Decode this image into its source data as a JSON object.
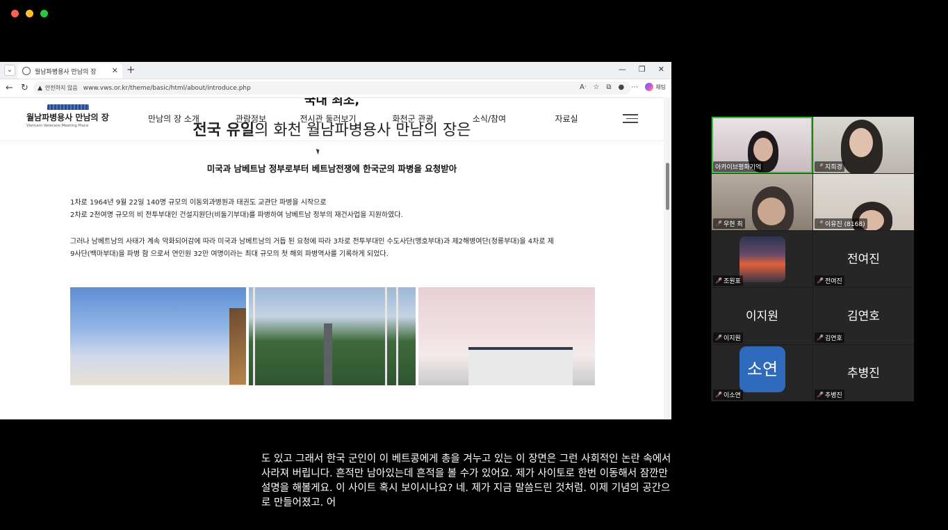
{
  "browser": {
    "tab_title": "월남파병용사 만남의 장",
    "security_label": "안전하지 않음",
    "url": "www.vws.or.kr/theme/basic/html/about/introduce.php",
    "copilot_label": "채팅"
  },
  "site": {
    "logo_ko": "월남파병용사 만남의 장",
    "logo_en": "Vietnam Veterans Meeting Place",
    "menu": [
      "만남의 장 소개",
      "관람정보",
      "전시관 둘러보기",
      "화천군 관광",
      "소식/참여",
      "자료실"
    ],
    "clipped_heading": "국내 최초,",
    "headline_bold": "전국 유일",
    "headline_rest": "의 화천 월남파병용사 만남의 장은",
    "subheading": "미국과 남베트남 정부로부터 베트남전쟁에 한국군의 파병을 요청받아",
    "para1_line1": "1차로 1964년 9월 22일 140명 규모의 이동외과병원과 태권도 교관단 파병을 시작으로",
    "para1_line2": "2차로 2천여명 규모의 비 전투부대인 건설지원단(비둘기부대)를 파병하여 남베트남 정부의 재건사업을 지원하였다.",
    "para2_line1": "그러나 남베트남의 사태가 계속 악화되어감에 따라 미국과 남베트남의 거듭 된 요청에 따라 3차로 전투부대인 수도사단(맹호부대)과 제2해병여단(청룡부대)을 4차로 제",
    "para2_line2": "9사단(백마부대)을 파병 함 으로서 연인원 32만 여명이라는 최대 규모의 첫 해외 파병역사를 기록하게 되었다."
  },
  "participants": [
    {
      "name": "아카이브평화기억",
      "muted": false,
      "video": true,
      "active": true
    },
    {
      "name": "지희경",
      "muted": true,
      "video": true
    },
    {
      "name": "우현 최",
      "muted": true,
      "video": true
    },
    {
      "name": "이유진 (8168)",
      "muted": true,
      "video": true
    },
    {
      "name": "조원표",
      "muted": true,
      "video": false
    },
    {
      "name": "전여진",
      "display": "전여진",
      "muted": true,
      "video": false
    },
    {
      "name": "이지원",
      "display": "이지원",
      "muted": true,
      "video": false
    },
    {
      "name": "김연호",
      "display": "김연호",
      "muted": true,
      "video": false
    },
    {
      "name": "이소연",
      "avatar_text": "소연",
      "muted": true,
      "video": false
    },
    {
      "name": "추병진",
      "display": "추병진",
      "muted": true,
      "video": false
    }
  ],
  "captions": [
    "도 있고 그래서 한국 군인이 이 베트콩에게 총을 겨누고 있는 이 장면은 그런 사회적인 논란 속에서",
    "사라져 버립니다. 흔적만 남아있는데 흔적을 볼 수가 있어요. 제가 사이토로 한번 이동해서 잠깐만",
    "설명을 해볼게요. 이 사이트 혹시 보이시나요? 네. 제가 지금 말씀드린 것처럼. 이제 기념의 공간으",
    "로 만들어졌고. 어"
  ],
  "colors": {
    "active_speaker": "#39c139",
    "muted_mic": "#e0463c",
    "avatar_blue": "#2e6bbd"
  }
}
